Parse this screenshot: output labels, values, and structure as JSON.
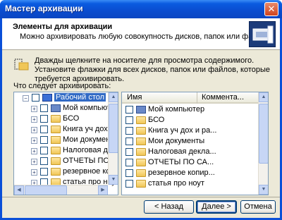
{
  "window": {
    "title": "Мастер архивации",
    "close_glyph": "✕"
  },
  "header": {
    "title": "Элементы для архивации",
    "subtitle": "Можно архивировать любую совокупность дисков, папок или файлов.",
    "icon": "backup-wizard-icon"
  },
  "info": {
    "icon": "folder-click-icon",
    "text": "Дважды щелкните на носителе для просмотра содержимого. Установите флажки для всех дисков, папок или файлов, которые требуется архивировать."
  },
  "tree": {
    "label": "Что следует архивировать:",
    "items": [
      {
        "label": "Рабочий стол",
        "icon": "desktop-icon",
        "expander": "−",
        "selected": true
      },
      {
        "label": "Мой компьютер",
        "icon": "computer-icon",
        "expander": "+"
      },
      {
        "label": "БСО",
        "icon": "folder-icon",
        "expander": "+"
      },
      {
        "label": "Книга уч дох и ра",
        "icon": "folder-icon",
        "expander": "+"
      },
      {
        "label": "Мои документы",
        "icon": "my-documents-icon",
        "expander": "+"
      },
      {
        "label": "Налоговая декла",
        "icon": "folder-icon",
        "expander": "+"
      },
      {
        "label": "ОТЧЕТЫ ПО СА",
        "icon": "folder-icon",
        "expander": "+"
      },
      {
        "label": "резервное копир",
        "icon": "folder-icon",
        "expander": "+"
      },
      {
        "label": "статья про ноут",
        "icon": "folder-icon",
        "expander": "+"
      }
    ]
  },
  "list": {
    "columns": {
      "name": "Имя",
      "comment": "Коммента..."
    },
    "items": [
      {
        "label": "Мой компьютер",
        "icon": "computer-icon"
      },
      {
        "label": "БСО",
        "icon": "folder-icon"
      },
      {
        "label": "Книга уч дох и ра...",
        "icon": "folder-icon"
      },
      {
        "label": "Мои документы",
        "icon": "my-documents-icon"
      },
      {
        "label": "Налоговая декла...",
        "icon": "folder-icon"
      },
      {
        "label": "ОТЧЕТЫ ПО СА...",
        "icon": "folder-icon"
      },
      {
        "label": "резервное копир...",
        "icon": "folder-icon"
      },
      {
        "label": "статья про ноут",
        "icon": "folder-icon"
      }
    ]
  },
  "buttons": {
    "back": "< Назад",
    "next": "Далее >",
    "cancel": "Отмена"
  },
  "colors": {
    "titlebar": "#0a4ccf",
    "dialog_bg": "#ece9d8",
    "selection": "#316ac5"
  }
}
